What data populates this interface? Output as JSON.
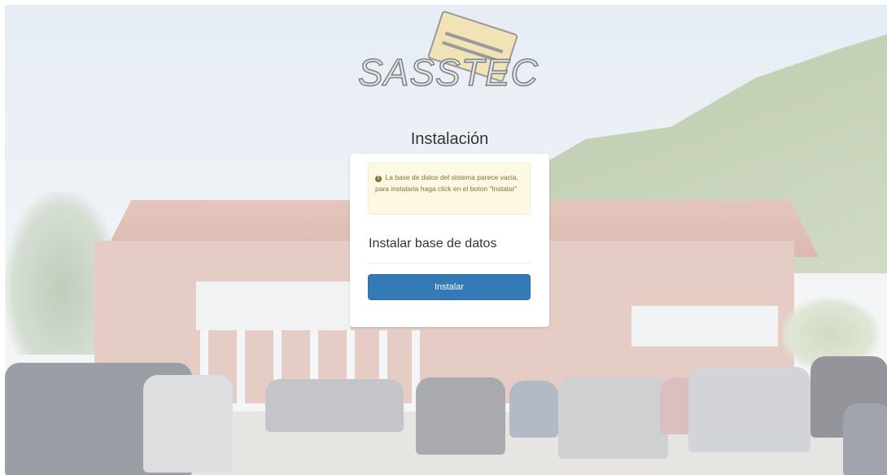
{
  "logo": {
    "text": "SASSTEC",
    "icon": "card-logo-icon"
  },
  "page": {
    "title": "Instalación"
  },
  "alert": {
    "icon": "exclamation-circle-icon",
    "message": "La base de datos del sistema parece vacia, para instalarla haga click en el boton \"Instalar\""
  },
  "panel": {
    "section_title": "Instalar base de datos",
    "install_button": "Instalar"
  },
  "colors": {
    "primary_button": "#337ab7",
    "alert_bg": "#fcf8e3",
    "alert_text": "#8a6d3b"
  }
}
